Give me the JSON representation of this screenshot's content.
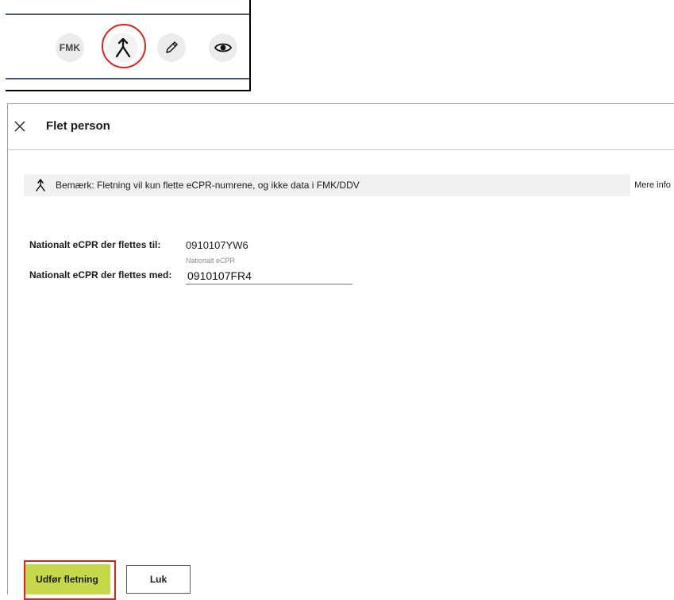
{
  "toolbar": {
    "fmk_label": "FMK",
    "buttons": [
      "fmk-button",
      "merge-icon",
      "pencil-icon",
      "eye-icon"
    ]
  },
  "dialog": {
    "title": "Flet person",
    "notice": {
      "text": "Bemærk: Fletning vil kun flette eCPR-numrene, og ikke data i FMK/DDV",
      "more_info": "Mere info"
    },
    "fields": {
      "target_label": "Nationalt eCPR der flettes til:",
      "target_value": "0910107YW6",
      "source_label": "Nationalt eCPR der flettes med:",
      "source_caption": "Nationalt eCPR",
      "source_value": "0910107FR4"
    },
    "actions": {
      "primary": "Udfør fletning",
      "secondary": "Luk"
    }
  },
  "colors": {
    "primary_button": "#c6d74a",
    "highlight": "#d6231e",
    "toolbar_rule": "#4a5a6e"
  }
}
